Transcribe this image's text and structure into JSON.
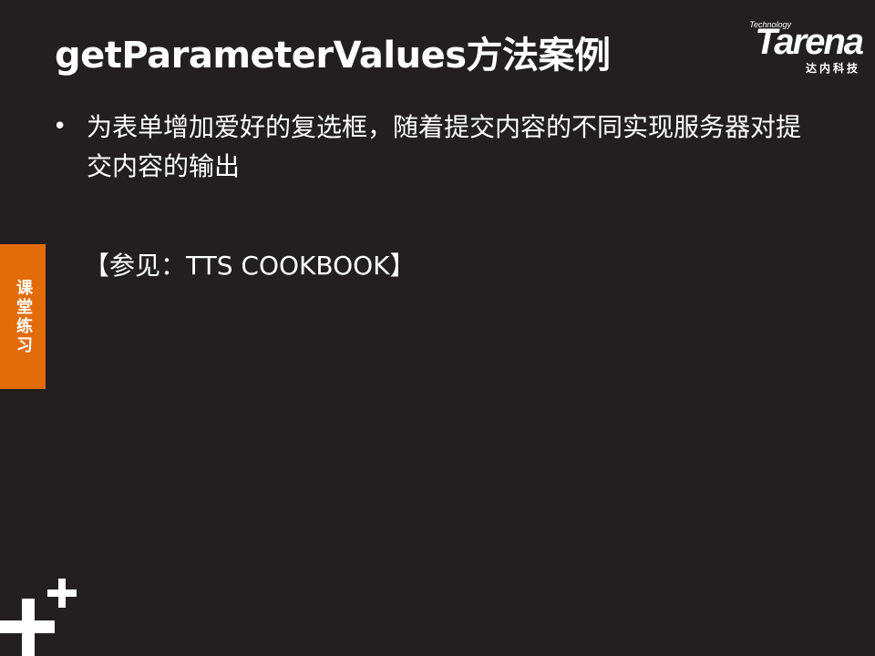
{
  "slide": {
    "title": "getParameterValues方法案例",
    "bullets": [
      "为表单增加爱好的复选框，随着提交内容的不同实现服务器对提交内容的输出"
    ],
    "bullet_symbol": "•",
    "reference": "【参见：TTS COOKBOOK】",
    "side_tab": "课堂练习"
  },
  "logo": {
    "tagline": "Technology",
    "wordmark": "Tarena",
    "chinese": "达内科技"
  },
  "icons": {
    "decoration": "plus-icon"
  },
  "colors": {
    "background": "#231f20",
    "text": "#ffffff",
    "accent": "#e36c0a"
  }
}
